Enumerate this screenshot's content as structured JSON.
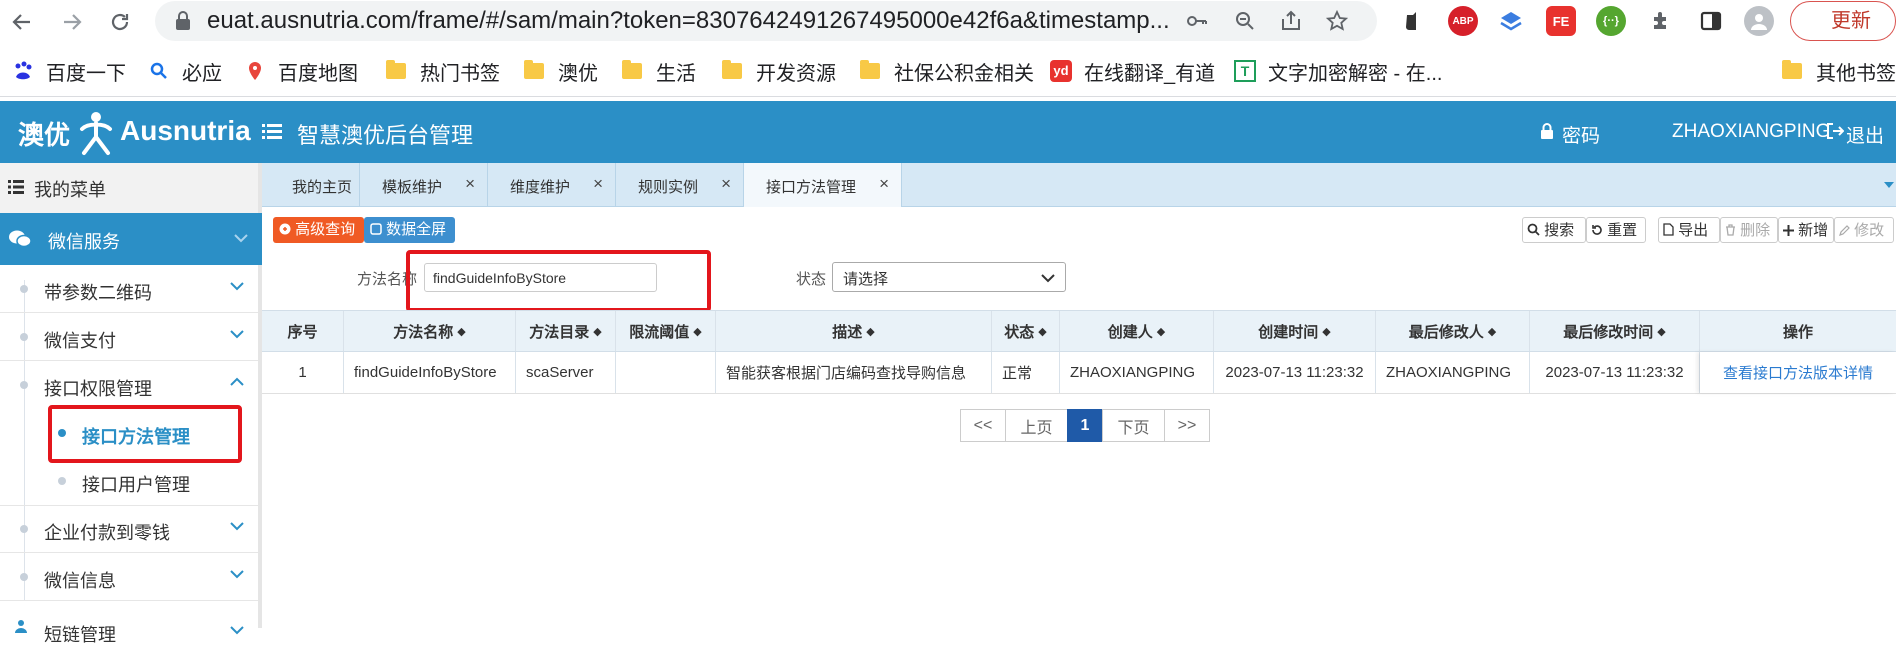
{
  "browser": {
    "url": "euat.ausnutria.com/frame/#/sam/main?token=8307642491267495000e42f6a&timestamp...",
    "update_label": "更新",
    "extensions": {
      "abp": "ABP",
      "fe": "FE"
    },
    "bookmarks": [
      {
        "label": "百度一下",
        "icon": "baidu-icon"
      },
      {
        "label": "必应",
        "icon": "search-icon"
      },
      {
        "label": "百度地图",
        "icon": "map-pin-icon"
      },
      {
        "label": "热门书签",
        "icon": "folder-icon"
      },
      {
        "label": "澳优",
        "icon": "folder-icon"
      },
      {
        "label": "生活",
        "icon": "folder-icon"
      },
      {
        "label": "开发资源",
        "icon": "folder-icon"
      },
      {
        "label": "社保公积金相关",
        "icon": "folder-icon"
      },
      {
        "label": "在线翻译_有道",
        "icon": "youdao-icon"
      },
      {
        "label": "文字加密解密 - 在...",
        "icon": "text-tool-icon"
      }
    ],
    "other_bookmarks": "其他书签"
  },
  "header": {
    "logo_cn": "澳优",
    "logo_en": "Ausnutria",
    "title": "智慧澳优后台管理",
    "password": "密码",
    "username": "ZHAOXIANGPING",
    "logout": "退出"
  },
  "sidebar": {
    "my_menu": "我的菜单",
    "wechat_service": "微信服务",
    "items": [
      {
        "label": "带参数二维码"
      },
      {
        "label": "微信支付"
      },
      {
        "label": "接口权限管理"
      },
      {
        "label": "企业付款到零钱"
      },
      {
        "label": "微信信息"
      },
      {
        "label": "短链管理"
      }
    ],
    "subitems": [
      {
        "label": "接口方法管理"
      },
      {
        "label": "接口用户管理"
      }
    ]
  },
  "tabs": [
    {
      "label": "我的主页"
    },
    {
      "label": "模板维护"
    },
    {
      "label": "维度维护"
    },
    {
      "label": "规则实例"
    },
    {
      "label": "接口方法管理"
    }
  ],
  "toolbar": {
    "advanced": "高级查询",
    "fullscreen": "数据全屏",
    "search": "搜索",
    "reset": "重置",
    "export": "导出",
    "delete": "删除",
    "add": "新增",
    "edit": "修改"
  },
  "filter": {
    "method_label": "方法名称",
    "method_value": "findGuideInfoByStore",
    "status_label": "状态",
    "status_value": "请选择"
  },
  "table": {
    "headers": [
      "序号",
      "方法名称",
      "方法目录",
      "限流阈值",
      "描述",
      "状态",
      "创建人",
      "创建时间",
      "最后修改人",
      "最后修改时间",
      "操作"
    ],
    "rows": [
      [
        "1",
        "findGuideInfoByStore",
        "scaServer",
        "",
        "智能获客根据门店编码查找导购信息",
        "正常",
        "ZHAOXIANGPING",
        "2023-07-13 11:23:32",
        "ZHAOXIANGPING",
        "2023-07-13 11:23:32",
        "查看接口方法版本详情"
      ]
    ]
  },
  "pager": {
    "first": "<<",
    "prev": "上页",
    "current": "1",
    "next": "下页",
    "last": ">>"
  },
  "colors": {
    "header_blue": "#2b8fc6",
    "highlight_red": "#e3161c",
    "advanced_orange": "#f05a24",
    "pager_active": "#1f5aa8"
  }
}
